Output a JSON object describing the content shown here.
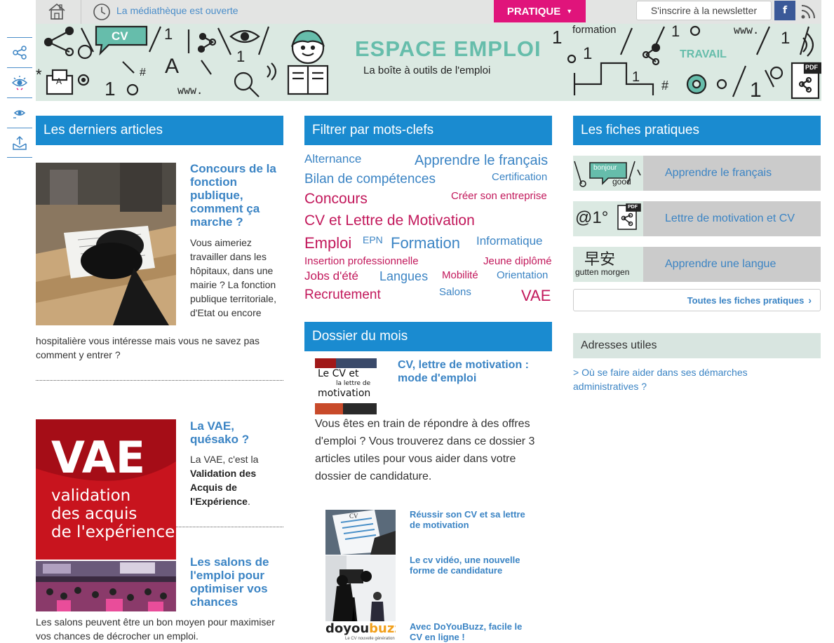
{
  "topbar": {
    "status": "La médiathèque est ouverte",
    "pratique": "PRATIQUE",
    "newsletter": "S'inscrire à la newsletter",
    "facebook": "f"
  },
  "banner": {
    "title": "ESPACE EMPLOI",
    "subtitle": "La boîte à outils de l'emploi",
    "deco_cv": "CV",
    "deco_formation": "formation",
    "deco_travail": "TRAVAIL",
    "deco_www": "www.",
    "deco_pdf": "PDF"
  },
  "sidebar": {
    "icons": [
      "share-icon",
      "eye-contrast-icon",
      "eye-small-icon",
      "export-icon"
    ]
  },
  "articles": {
    "header": "Les derniers articles",
    "items": [
      {
        "title": "Concours de la fonction publique, comment ça marche ?",
        "body": "Vous aimeriez travailler dans les hôpitaux, dans une mairie ? La fonction publique territoriale, d'Etat ou encore",
        "wrap": "hospitalière vous intéresse mais vous ne savez pas comment y entrer ?"
      },
      {
        "title": "La VAE, quésako ?",
        "body_pre": "La VAE, c'est la ",
        "body_strong": "Validation des Acquis de l'Expérience",
        "body_post": ".",
        "img_lines": [
          "VAE",
          "validation",
          "des acquis",
          "de l'expérience"
        ]
      },
      {
        "title": "Les salons de l'emploi pour optimiser vos chances",
        "wrap": "Les salons peuvent être un bon moyen pour maximiser vos chances de décrocher un emploi."
      }
    ]
  },
  "tags": {
    "header": "Filtrer par mots-clefs",
    "items": [
      {
        "label": "Alternance",
        "color": "blue"
      },
      {
        "label": "Apprendre le français",
        "color": "blue"
      },
      {
        "label": "Bilan de compétences",
        "color": "blue"
      },
      {
        "label": "Certification",
        "color": "blue"
      },
      {
        "label": "Concours",
        "color": "pink"
      },
      {
        "label": "Créer son entreprise",
        "color": "pink"
      },
      {
        "label": "CV et Lettre de Motivation",
        "color": "pink"
      },
      {
        "label": "Emploi",
        "color": "pink"
      },
      {
        "label": "EPN",
        "color": "blue"
      },
      {
        "label": "Formation",
        "color": "blue"
      },
      {
        "label": "Informatique",
        "color": "blue"
      },
      {
        "label": "Insertion professionnelle",
        "color": "pink"
      },
      {
        "label": "Jeune diplômé",
        "color": "pink"
      },
      {
        "label": "Jobs d'été",
        "color": "pink"
      },
      {
        "label": "Langues",
        "color": "blue"
      },
      {
        "label": "Mobilité",
        "color": "pink"
      },
      {
        "label": "Orientation",
        "color": "blue"
      },
      {
        "label": "Recrutement",
        "color": "pink"
      },
      {
        "label": "Salons",
        "color": "blue"
      },
      {
        "label": "VAE",
        "color": "pink"
      }
    ]
  },
  "dossier": {
    "header": "Dossier du mois",
    "title": "CV, lettre de motivation : mode d'emploi",
    "thumb_text": [
      "Le CV et",
      "la lettre de",
      "motivation"
    ],
    "body": "Vous êtes en train de répondre à des offres d'emploi ? Vous trouverez dans ce dossier 3 articles utiles pour vous aider dans votre dossier de candidature.",
    "subs": [
      {
        "title": "Réussir son CV et sa lettre de motivation"
      },
      {
        "title": "Le cv vidéo, une nouvelle forme de candidature"
      },
      {
        "title": "Avec DoYouBuzz, facile le CV en ligne !",
        "logo_a": "doyou",
        "logo_b": "buzz",
        "logo_tag": "Le CV nouvelle génération"
      }
    ]
  },
  "fiches": {
    "header": "Les fiches pratiques",
    "items": [
      {
        "label": "Apprendre le français",
        "thumb_words": [
          "bonjour",
          "good"
        ]
      },
      {
        "label": "Lettre de motivation et CV",
        "thumb_words": [
          "@1°",
          "PDF"
        ]
      },
      {
        "label": "Apprendre une langue",
        "thumb_words": [
          "早安",
          "gutten morgen"
        ]
      }
    ],
    "all_link": "Toutes les fiches pratiques"
  },
  "adresses": {
    "header": "Adresses utiles",
    "link": "> Où se faire aider dans ses démarches administratives ?"
  },
  "colors": {
    "accent_blue": "#1a8bd0",
    "link_blue": "#3b84c4",
    "pink": "#e0147b",
    "banner_green": "#66bdab"
  }
}
